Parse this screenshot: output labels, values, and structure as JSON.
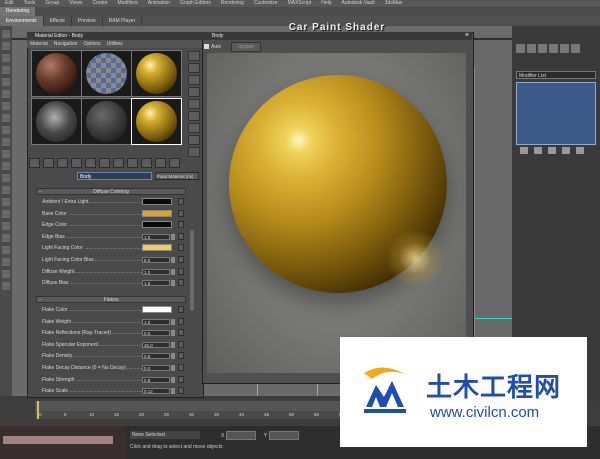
{
  "page_title": "Car Paint Shader",
  "menubar": {
    "items": [
      "Edit",
      "Tools",
      "Group",
      "Views",
      "Create",
      "Modifiers",
      "Animation",
      "Graph Editors",
      "Rendering",
      "Customize",
      "MAXScript",
      "Help",
      "Autodesk Vault",
      "3dsMax"
    ]
  },
  "ribbon_tabs": [
    {
      "label": "Rendering",
      "active": true
    }
  ],
  "toolbar2": [
    {
      "label": "Environments",
      "active": true
    },
    {
      "label": "Effects",
      "active": false
    },
    {
      "label": "Preview",
      "active": false
    },
    {
      "label": "RAM Player",
      "active": false
    }
  ],
  "material_editor": {
    "title": "Material Editor - Body",
    "menu": [
      "Material",
      "Navigation",
      "Options",
      "Utilities"
    ],
    "material_name": "Body",
    "material_type": "Paint Material (mi)",
    "rollouts": {
      "diffuse": {
        "title": "Diffuse Coloring",
        "params": [
          {
            "label": "Ambient / Extra Light",
            "kind": "swatch",
            "color": "#0a0a0a"
          },
          {
            "label": "Base Color",
            "kind": "swatch",
            "color": "#e3a21a"
          },
          {
            "label": "Edge Color",
            "kind": "swatch",
            "color": "#0a0a0a"
          },
          {
            "label": "Edge Bias",
            "kind": "value",
            "value": "1.0"
          },
          {
            "label": "Light Facing Color",
            "kind": "swatch",
            "color": "#f6c85a"
          },
          {
            "label": "Light Facing Color Bias",
            "kind": "value",
            "value": "8.0"
          },
          {
            "label": "Diffuse Weight",
            "kind": "value",
            "value": "1.0"
          },
          {
            "label": "Diffuse Bias",
            "kind": "value",
            "value": "1.5"
          }
        ]
      },
      "flakes": {
        "title": "Flakes",
        "params": [
          {
            "label": "Flake Color",
            "kind": "swatch",
            "color": "#ffffff"
          },
          {
            "label": "Flake Weight",
            "kind": "value",
            "value": "1.0"
          },
          {
            "label": "Flake Reflections (Ray-Traced)",
            "kind": "value",
            "value": "0.0"
          },
          {
            "label": "Flake Specular Exponent",
            "kind": "value",
            "value": "45.0"
          },
          {
            "label": "Flake Density",
            "kind": "value",
            "value": "0.5"
          },
          {
            "label": "Flake Decay Distance (0 = No Decay)",
            "kind": "value",
            "value": "0.0"
          },
          {
            "label": "Flake Strength",
            "kind": "value",
            "value": "0.8"
          },
          {
            "label": "Flake Scale",
            "kind": "value",
            "value": "0.12"
          }
        ]
      }
    }
  },
  "render_window": {
    "title": "Body",
    "auto_label": "Auto",
    "update_label": "Update"
  },
  "command_panel": {
    "modifier_list": "Modifier List"
  },
  "timeline": {
    "ticks": [
      "0",
      "5",
      "10",
      "15",
      "20",
      "25",
      "30",
      "35",
      "40",
      "45",
      "50",
      "55",
      "60",
      "65",
      "70",
      "75"
    ]
  },
  "status": {
    "selection": "None Selected",
    "prompt": "Click and drag to select and move objects",
    "x_label": "X",
    "y_label": "Y"
  },
  "watermark": {
    "cn_text": "土木工程网",
    "url": "www.civilcn.com"
  }
}
